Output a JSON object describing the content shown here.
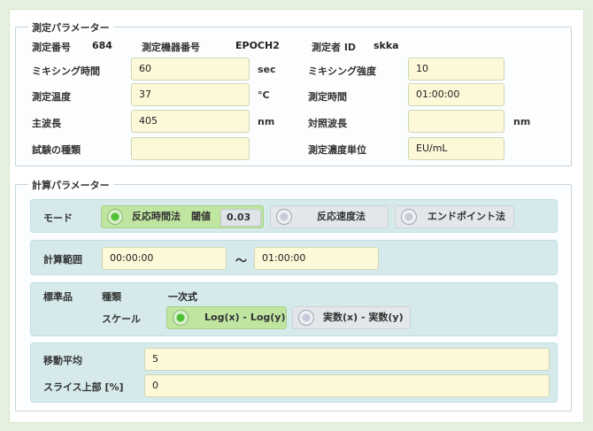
{
  "measurement": {
    "group_title": "測定パラメーター",
    "id_label": "測定番号",
    "id_value": "684",
    "device_label": "測定機器番号",
    "device_value": "EPOCH2",
    "operator_label": "測定者 ID",
    "operator_value": "skka",
    "mixing_time_label": "ミキシング時間",
    "mixing_time_value": "60",
    "mixing_time_unit": "sec",
    "mixing_strength_label": "ミキシング強度",
    "mixing_strength_value": "10",
    "temp_label": "測定温度",
    "temp_value": "37",
    "temp_unit": "°C",
    "meas_time_label": "測定時間",
    "meas_time_value": "01:00:00",
    "main_wl_label": "主波長",
    "main_wl_value": "405",
    "main_wl_unit": "nm",
    "ref_wl_label": "対照波長",
    "ref_wl_value": "",
    "ref_wl_unit": "nm",
    "test_type_label": "試験の種類",
    "test_type_value": "",
    "conc_unit_label": "測定濃度単位",
    "conc_unit_value": "EU/mL"
  },
  "calc": {
    "group_title": "計算パラメーター",
    "mode_label": "モード",
    "mode_options": [
      "反応時間法",
      "反応速度法",
      "エンドポイント法"
    ],
    "mode_selected": 0,
    "threshold_label": "閾値",
    "threshold_value": "0.03",
    "range_label": "計算範囲",
    "range_start": "00:00:00",
    "range_sep": "〜",
    "range_end": "01:00:00",
    "standard_label": "標準品",
    "type_label": "種類",
    "type_value": "一次式",
    "scale_label": "スケール",
    "scale_options": [
      "Log(x) - Log(y)",
      "実数(x) - 実数(y)"
    ],
    "scale_selected": 0,
    "moving_avg_label": "移動平均",
    "moving_avg_value": "5",
    "slice_label": "スライス上部 [%]",
    "slice_value": "0"
  }
}
